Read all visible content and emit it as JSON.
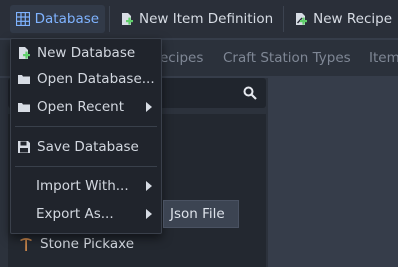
{
  "toolbar": {
    "database": "Database",
    "new_item_definition": "New Item Definition",
    "new_recipe": "New Recipe"
  },
  "tabs": [
    "ecipes",
    "Craft Station Types",
    "Item"
  ],
  "menu": {
    "new_database": "New Database",
    "open_database": "Open Database...",
    "open_recent": "Open Recent",
    "save_database": "Save Database",
    "import_with": "Import With...",
    "export_as": "Export As..."
  },
  "submenu": {
    "json_file": "Json File"
  },
  "list": {
    "item_0": "Stone Pickaxe"
  },
  "colors": {
    "accent": "#7fb3ff",
    "add_green": "#5fcf6a",
    "pickaxe_brown": "#c4834a"
  }
}
